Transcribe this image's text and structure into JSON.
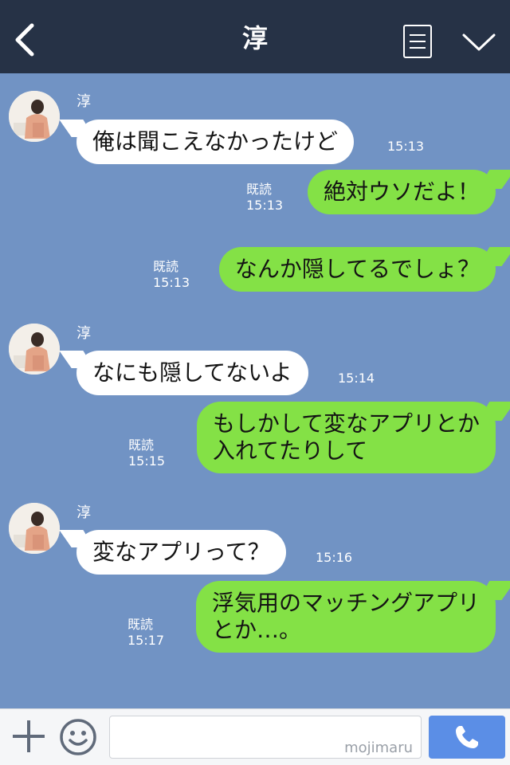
{
  "header": {
    "title": "淳",
    "back_icon": "chevron-left-icon",
    "menu_icon": "list-icon",
    "collapse_icon": "chevron-down-icon"
  },
  "messages": [
    {
      "side": "in",
      "sender": "淳",
      "text": "俺は聞こえなかったけど",
      "time": "15:13"
    },
    {
      "side": "out",
      "read": "既読",
      "time": "15:13",
      "text": "絶対ウソだよ！"
    },
    {
      "side": "out",
      "read": "既読",
      "time": "15:13",
      "text": "なんか隠してるでしょ？"
    },
    {
      "side": "in",
      "sender": "淳",
      "text": "なにも隠してないよ",
      "time": "15:14"
    },
    {
      "side": "out",
      "read": "既読",
      "time": "15:15",
      "lines": [
        "もしかして変なアプリとか",
        "入れてたりして"
      ]
    },
    {
      "side": "in",
      "sender": "淳",
      "text": "変なアプリって？",
      "time": "15:16"
    },
    {
      "side": "out",
      "read": "既読",
      "time": "15:17",
      "lines": [
        "浮気用のマッチングアプリ",
        "とか…。"
      ]
    }
  ],
  "footer": {
    "plus_icon": "plus-icon",
    "emoji_icon": "smiley-icon",
    "input_value": "",
    "watermark": "mojimaru",
    "call_icon": "phone-icon"
  },
  "colors": {
    "header_bg": "#263246",
    "chat_bg": "#7193c4",
    "outgoing_bubble": "#84e146",
    "incoming_bubble": "#ffffff",
    "call_button": "#5b8ee6"
  }
}
